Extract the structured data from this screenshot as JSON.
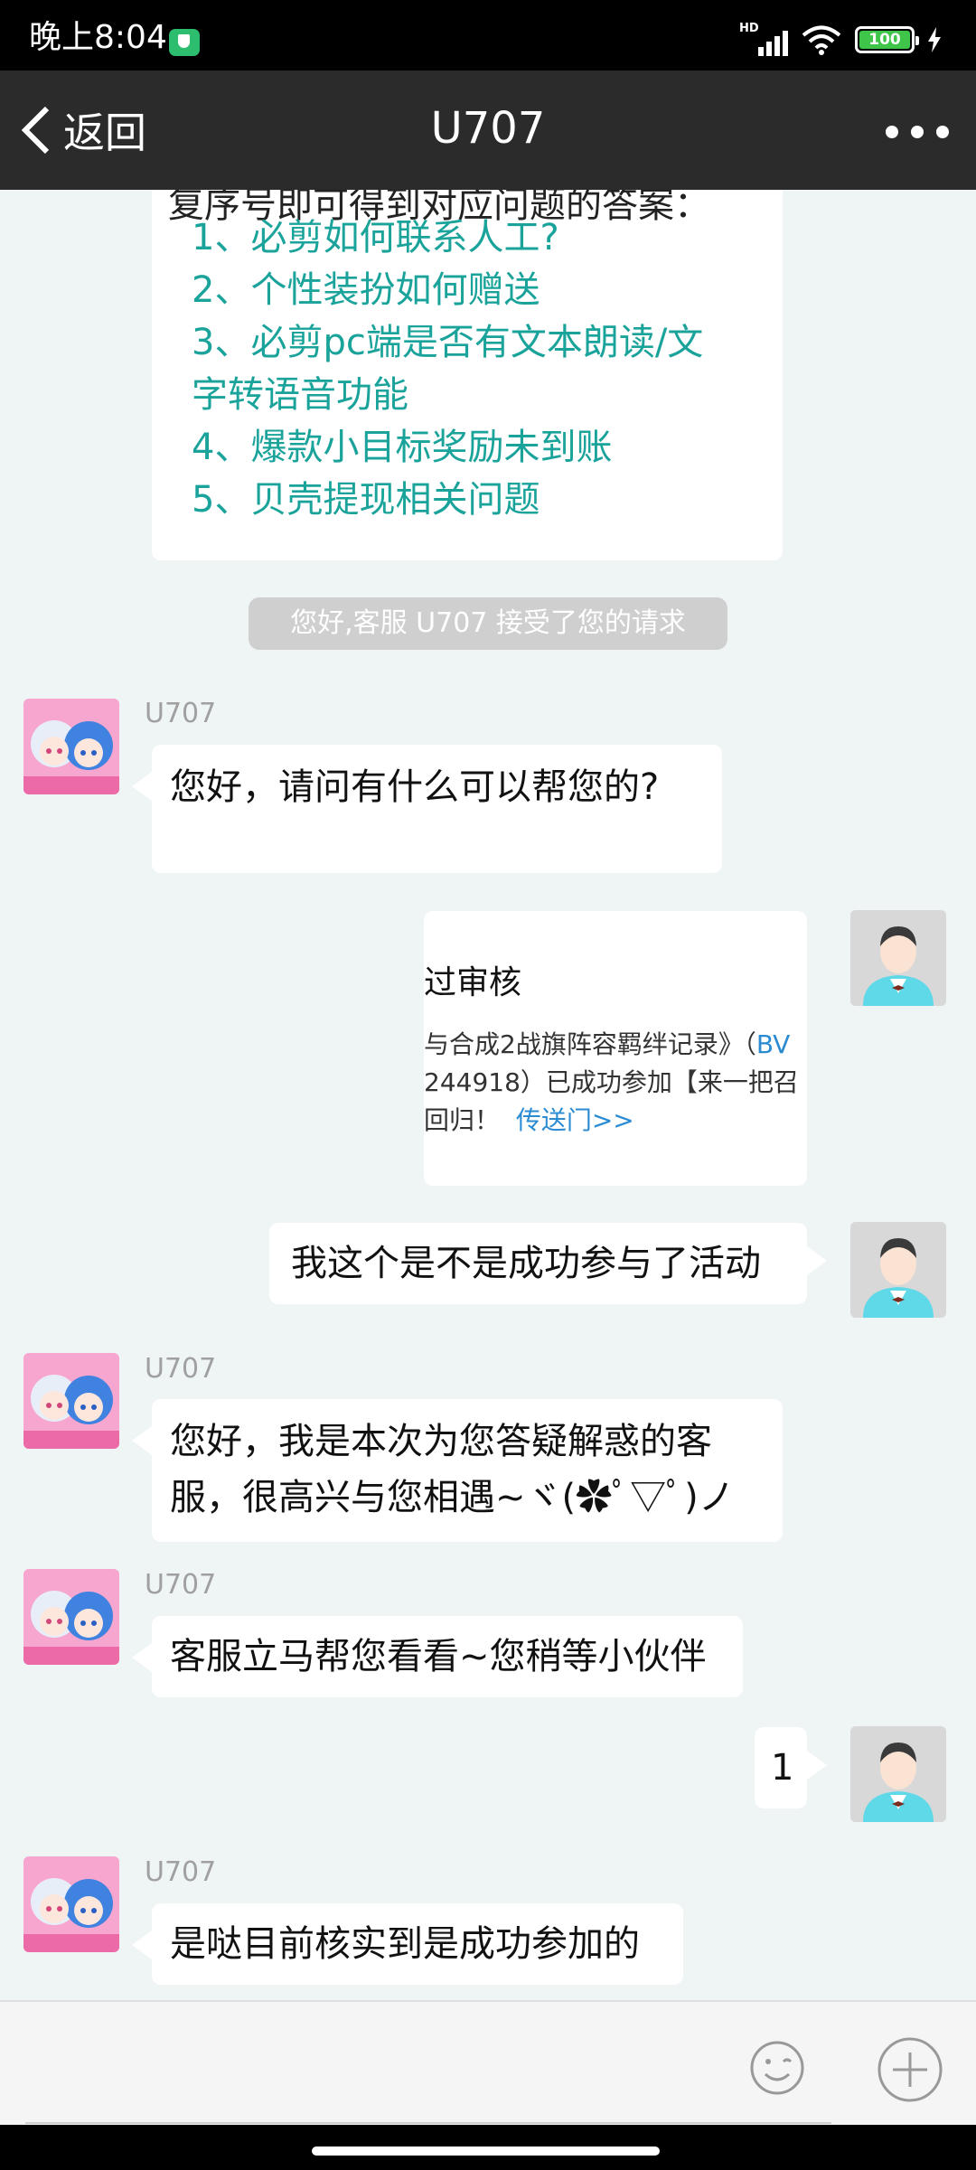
{
  "status_bar": {
    "time": "晚上8:04",
    "network_label": "HD",
    "battery": "100"
  },
  "header": {
    "back_label": "返回",
    "title": "U707"
  },
  "chat": {
    "menu": {
      "intro": "复序号即可得到对应问题的答案：",
      "items": [
        "1、必剪如何联系人工?",
        "2、个性装扮如何赠送",
        "3、必剪pc端是否有文本朗读/文字转语音功能",
        "4、爆款小目标奖励未到账",
        "5、贝壳提现相关问题"
      ]
    },
    "system_notice": "您好,客服 U707 接受了您的请求",
    "agent_name": "U707",
    "messages": [
      {
        "text": "您好，请问有什么可以帮您的?"
      },
      {
        "card_title": "过审核",
        "card_line1": "与合成2战旗阵容羁绊记录》（",
        "card_line1_tail": "BV",
        "card_line2": "244918）已成功参加【来一把召",
        "card_line3": "回归！",
        "card_link": "传送门>>"
      },
      {
        "text": "我这个是不是成功参与了活动"
      },
      {
        "text": "您好，我是本次为您答疑解惑的客服，很高兴与您相遇~ヾ(✿ﾟ▽ﾟ)ノ"
      },
      {
        "text": "客服立马帮您看看~您稍等小伙伴"
      },
      {
        "text": "1"
      },
      {
        "text": "是哒目前核实到是成功参加的"
      }
    ]
  },
  "colors": {
    "header_bg": "#2b2b2b",
    "chat_bg": "#eff4f4",
    "link_teal": "#1aa39a",
    "notice_bg": "#cfcfcf"
  }
}
